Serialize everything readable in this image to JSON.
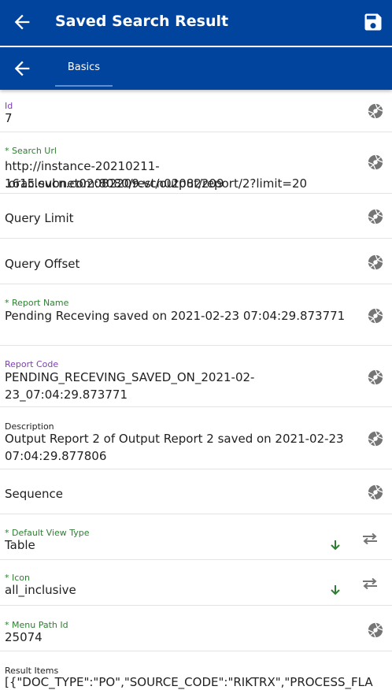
{
  "appbar": {
    "title": "Saved Search Result"
  },
  "tabs": [
    {
      "label": "Basics"
    }
  ],
  "fields": {
    "id": {
      "label": "Id",
      "value": "7"
    },
    "search_url": {
      "label": "* Search Url",
      "value_line1": "http://instance-20210211-1615.subnet02082209.vcn02082209",
      "value_line2": ".oraclevcn.com:8080/rest/output/report/2?limit=20"
    },
    "query_limit": {
      "label": "Query Limit"
    },
    "query_offset": {
      "label": "Query Offset"
    },
    "report_name": {
      "label": "* Report Name",
      "value": "Pending Receving saved on 2021-02-23 07:04:29.873771"
    },
    "report_code": {
      "label": "Report Code",
      "value": "PENDING_RECEVING_SAVED_ON_2021-02-23_07:04:29.873771"
    },
    "description": {
      "label": "Description",
      "value_line1": "Output Report 2 of Output Report 2 saved on 2021-02-23",
      "value_line2": "07:04:29.877806"
    },
    "sequence": {
      "label": "Sequence"
    },
    "default_view_type": {
      "label": "* Default View Type",
      "value": "Table"
    },
    "icon": {
      "label": "* Icon",
      "value": "all_inclusive"
    },
    "menu_path_id": {
      "label": "* Menu Path Id",
      "value": "25074"
    },
    "result_items": {
      "label": "Result Items",
      "value": "[{\"DOC_TYPE\":\"PO\",\"SOURCE_CODE\":\"RIKTRX\",\"PROCESS_FLA"
    }
  },
  "colors": {
    "primary": "#00449e",
    "required_label": "#2e7d32",
    "optional_label": "#7b3fb0"
  },
  "icons": [
    "arrow-left-icon",
    "save-icon",
    "aperture-icon",
    "arrow-down-icon",
    "swap-icon"
  ]
}
